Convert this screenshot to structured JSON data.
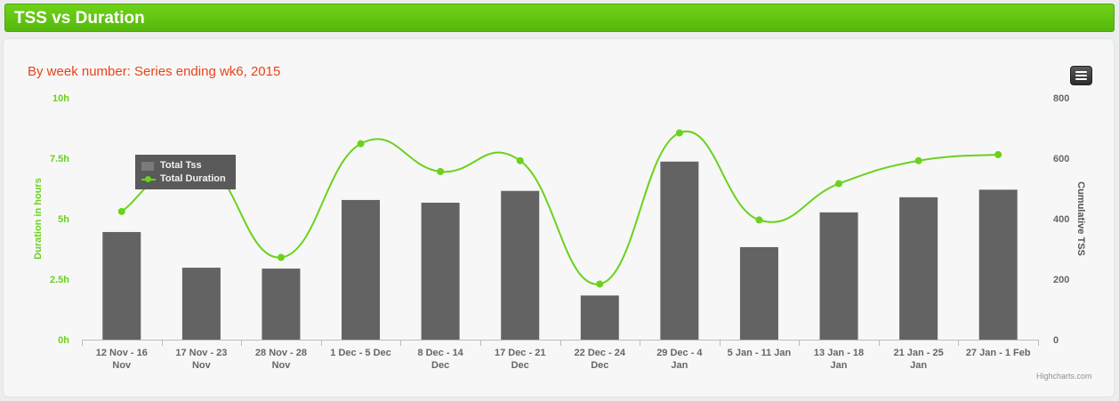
{
  "header": {
    "title": "TSS vs Duration"
  },
  "menu": {
    "icon": "hamburger-menu-icon"
  },
  "credits": "Highcharts.com",
  "colors": {
    "header_green": "#5cc411",
    "bar": "#636363",
    "line": "#6ad21b",
    "subtitle": "#e8431a"
  },
  "chart_data": {
    "type": "bar",
    "subtitle": "By week number: Series ending wk6, 2015",
    "categories": [
      [
        "12 Nov - 16",
        "Nov"
      ],
      [
        "17 Nov - 23",
        "Nov"
      ],
      [
        "28 Nov - 28",
        "Nov"
      ],
      [
        "1 Dec - 5 Dec",
        ""
      ],
      [
        "8 Dec - 14",
        "Dec"
      ],
      [
        "17 Dec - 21",
        "Dec"
      ],
      [
        "22 Dec - 24",
        "Dec"
      ],
      [
        "29 Dec - 4",
        "Jan"
      ],
      [
        "5 Jan - 11 Jan",
        ""
      ],
      [
        "13 Jan - 18",
        "Jan"
      ],
      [
        "21 Jan - 25",
        "Jan"
      ],
      [
        "27 Jan - 1 Feb",
        ""
      ]
    ],
    "y_left": {
      "label": "Duration in hours",
      "ticks": [
        "0h",
        "2.5h",
        "5h",
        "7.5h",
        "10h"
      ],
      "min": 0,
      "max": 10
    },
    "y_right": {
      "label": "Cumulative TSS",
      "ticks": [
        "0",
        "200",
        "400",
        "600",
        "800"
      ],
      "min": 0,
      "max": 800
    },
    "series": [
      {
        "name": "Total Tss",
        "type": "column",
        "axis": "right",
        "values": [
          356,
          238,
          235,
          462,
          453,
          492,
          146,
          589,
          306,
          421,
          471,
          496
        ]
      },
      {
        "name": "Total Duration",
        "type": "spline",
        "axis": "left",
        "values": [
          5.3,
          7.4,
          3.4,
          8.1,
          6.95,
          7.4,
          2.3,
          8.55,
          4.95,
          6.45,
          7.4,
          7.65
        ]
      }
    ],
    "legend": {
      "placement": "top-left"
    },
    "grid": false
  }
}
